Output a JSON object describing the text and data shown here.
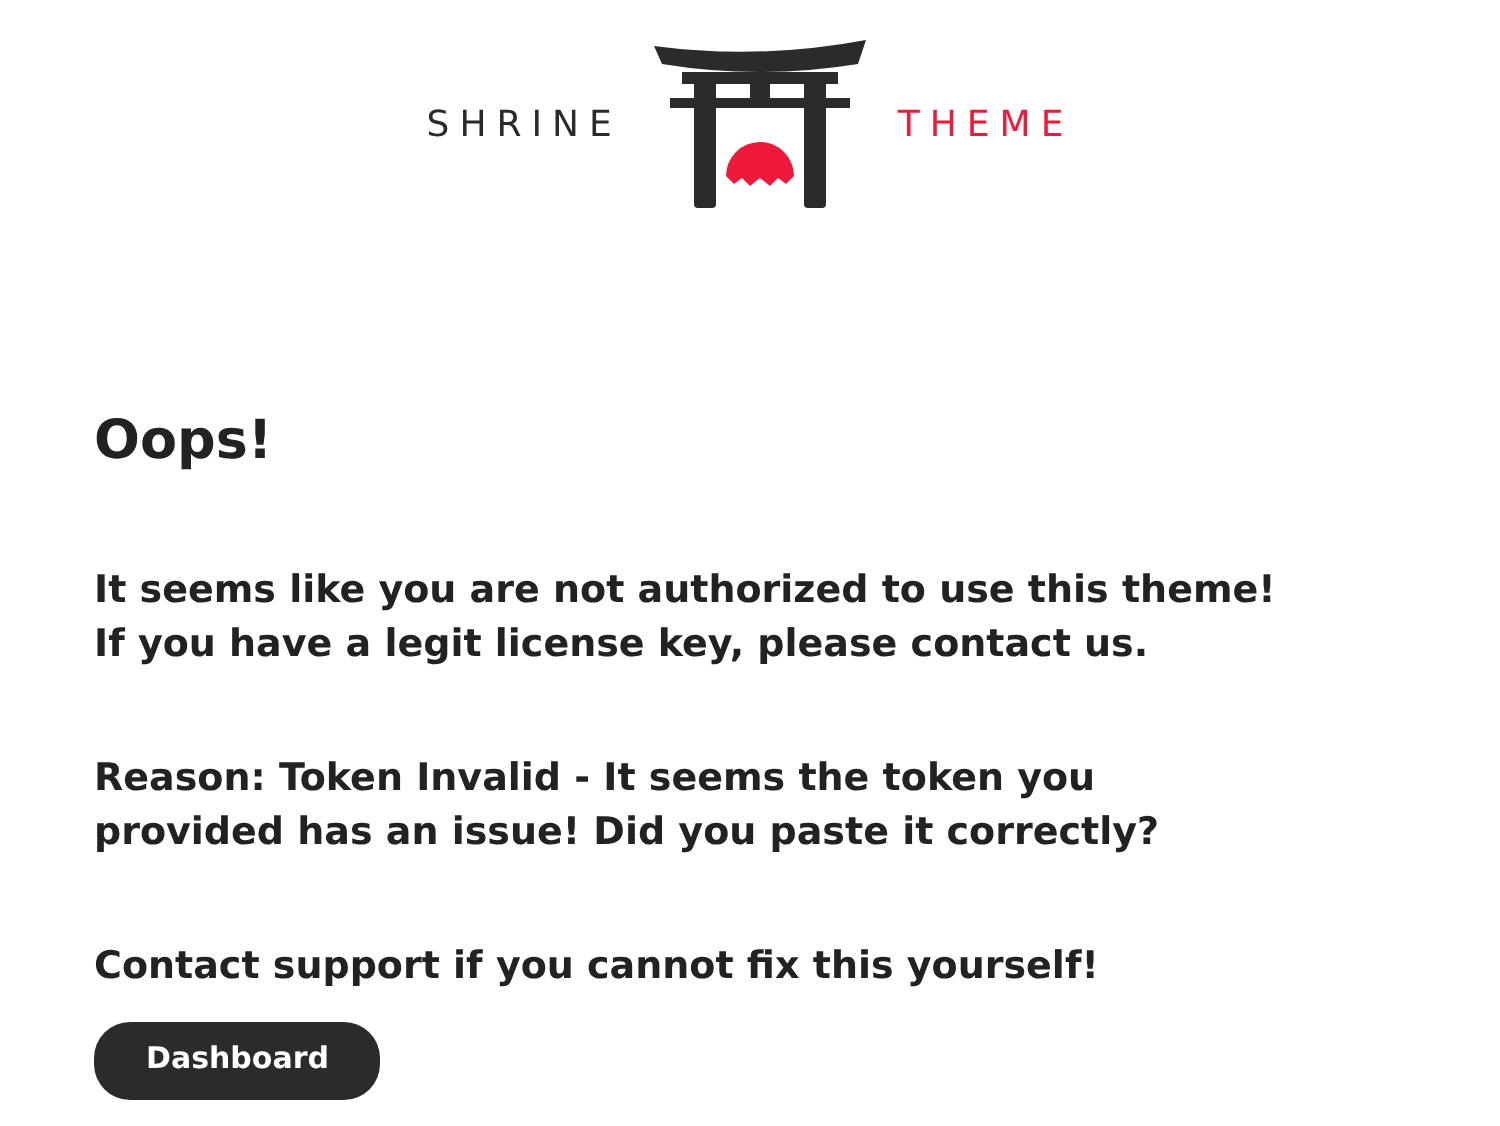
{
  "logo": {
    "left_word": "SHRINE",
    "right_word": "THEME"
  },
  "heading": "Oops!",
  "paragraphs": [
    {
      "lines": [
        "It seems like you are not authorized to use this theme!",
        "If you have a legit license key, please contact us."
      ]
    },
    {
      "lines": [
        "Reason: Token Invalid - It seems the token you",
        "provided has an issue! Did you paste it correctly?"
      ]
    },
    {
      "lines": [
        "Contact support if you cannot fix this yourself!"
      ]
    }
  ],
  "button": {
    "label": "Dashboard"
  }
}
